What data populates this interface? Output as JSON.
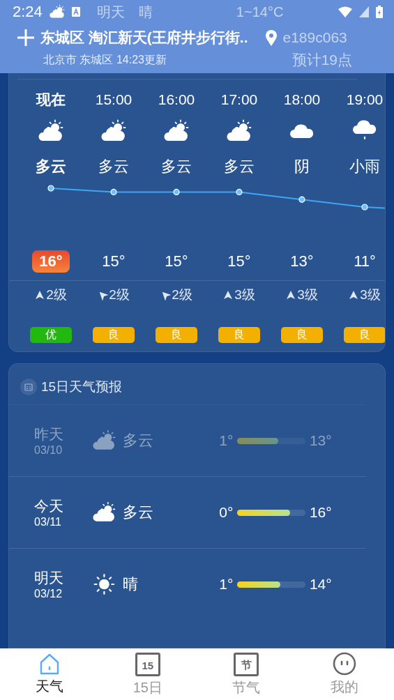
{
  "status_bar": {
    "time": "2:24",
    "behind": [
      "明天",
      "晴",
      "1~14°C"
    ]
  },
  "header": {
    "location": "东城区 淘汇新天(王府井步行街..",
    "note": "e189c063",
    "subtitle": "北京市 东城区  14:23更新",
    "sub_note": "预计19点"
  },
  "hourly": [
    {
      "time": "现在",
      "kind": "partly_cloudy",
      "condition": "多云",
      "temp": "16°",
      "wind": {
        "kind": "north",
        "text": "2级"
      },
      "aqi": "优",
      "color": "#22b80f",
      "selected": true
    },
    {
      "time": "15:00",
      "kind": "partly_cloudy",
      "condition": "多云",
      "temp": "15°",
      "wind": {
        "kind": "northeast",
        "text": "2级"
      },
      "aqi": "良",
      "color": "#f3b000",
      "selected": false
    },
    {
      "time": "16:00",
      "kind": "partly_cloudy",
      "condition": "多云",
      "temp": "15°",
      "wind": {
        "kind": "northeast",
        "text": "2级"
      },
      "aqi": "良",
      "color": "#f3b000",
      "selected": false
    },
    {
      "time": "17:00",
      "kind": "partly_cloudy",
      "condition": "多云",
      "temp": "15°",
      "wind": {
        "kind": "north",
        "text": "3级"
      },
      "aqi": "良",
      "color": "#f3b000",
      "selected": false
    },
    {
      "time": "18:00",
      "kind": "cloudy",
      "condition": "阴",
      "temp": "13°",
      "wind": {
        "kind": "north",
        "text": "3级"
      },
      "aqi": "良",
      "color": "#f3b000",
      "selected": false
    },
    {
      "time": "19:00",
      "kind": "rain",
      "condition": "小雨",
      "temp": "11°",
      "wind": {
        "kind": "north",
        "text": "3级"
      },
      "aqi": "良",
      "color": "#f3b000",
      "selected": false
    }
  ],
  "forecast": {
    "title": "15日天气预报",
    "days": [
      {
        "day": "昨天",
        "date": "03/10",
        "kind": "partly_cloudy",
        "condition": "多云",
        "low": "1°",
        "high": "13°",
        "level": 0.6,
        "past": true
      },
      {
        "day": "今天",
        "date": "03/11",
        "kind": "partly_cloudy",
        "condition": "多云",
        "low": "0°",
        "high": "16°",
        "level": 0.78,
        "past": false
      },
      {
        "day": "明天",
        "date": "03/12",
        "kind": "sunny",
        "condition": "晴",
        "low": "1°",
        "high": "14°",
        "level": 0.63,
        "past": false
      }
    ]
  },
  "nav": [
    {
      "label": "天气",
      "kind": "home",
      "selected": true
    },
    {
      "label": "15日",
      "kind": "calendar",
      "icon_text": "15",
      "selected": false
    },
    {
      "label": "节气",
      "kind": "calendar",
      "icon_text": "节",
      "selected": false
    },
    {
      "label": "我的",
      "kind": "face",
      "selected": false
    }
  ]
}
